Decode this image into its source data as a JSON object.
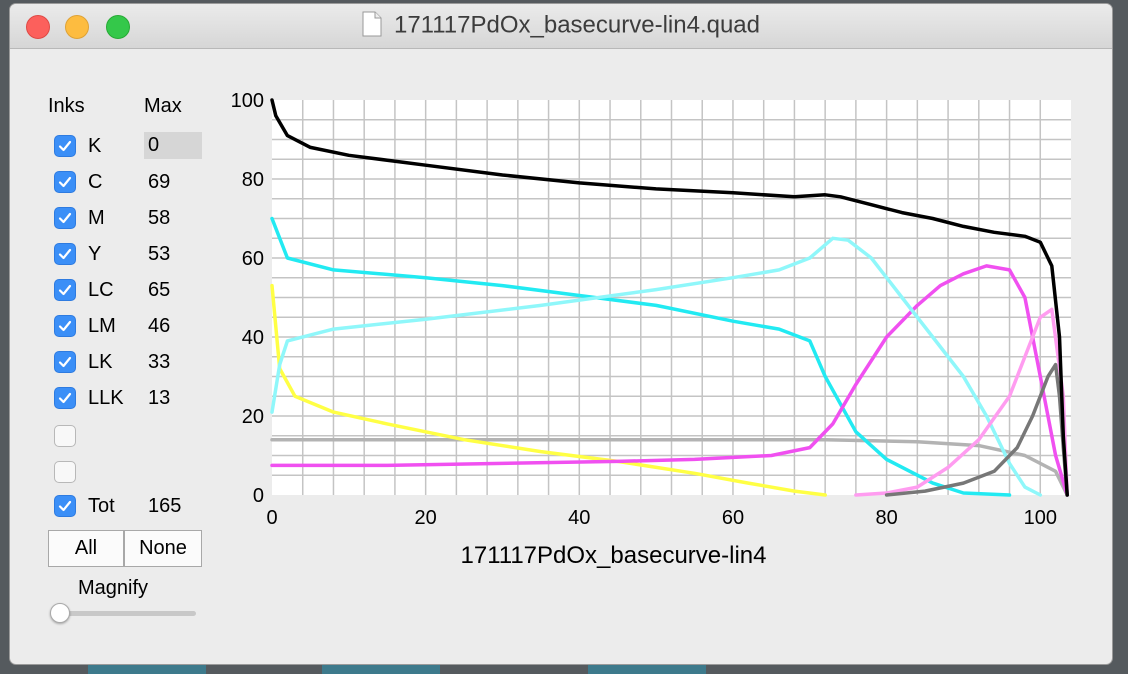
{
  "window": {
    "title": "171117PdOx_basecurve-lin4.quad"
  },
  "panel": {
    "inks_header": "Inks",
    "max_header": "Max",
    "inks": [
      {
        "name": "K",
        "max": "0",
        "checked": true
      },
      {
        "name": "C",
        "max": "69",
        "checked": true
      },
      {
        "name": "M",
        "max": "58",
        "checked": true
      },
      {
        "name": "Y",
        "max": "53",
        "checked": true
      },
      {
        "name": "LC",
        "max": "65",
        "checked": true
      },
      {
        "name": "LM",
        "max": "46",
        "checked": true
      },
      {
        "name": "LK",
        "max": "33",
        "checked": true
      },
      {
        "name": "LLK",
        "max": "13",
        "checked": true
      },
      {
        "name": "",
        "max": "",
        "checked": false
      },
      {
        "name": "",
        "max": "",
        "checked": false
      },
      {
        "name": "Tot",
        "max": "165",
        "checked": true
      }
    ],
    "all_label": "All",
    "none_label": "None",
    "magnify_label": "Magnify",
    "magnify_value": 0
  },
  "chart_data": {
    "type": "line",
    "xlabel": "171117PdOx_basecurve-lin4",
    "ylabel": "",
    "xlim": [
      0,
      104
    ],
    "ylim": [
      0,
      100
    ],
    "xticks": [
      0,
      20,
      40,
      60,
      80,
      100
    ],
    "yticks": [
      0,
      20,
      40,
      60,
      80,
      100
    ],
    "grid": true,
    "series": [
      {
        "color": "#b3b3b3",
        "points": [
          [
            0,
            14
          ],
          [
            20,
            14
          ],
          [
            40,
            14
          ],
          [
            60,
            14
          ],
          [
            72,
            14
          ],
          [
            84,
            13.5
          ],
          [
            92,
            12.5
          ],
          [
            98,
            10
          ],
          [
            102,
            6
          ],
          [
            103.5,
            0
          ]
        ]
      },
      {
        "color": "#ffff44",
        "points": [
          [
            0,
            53
          ],
          [
            1,
            32
          ],
          [
            3,
            25
          ],
          [
            8,
            21
          ],
          [
            15,
            18
          ],
          [
            25,
            14
          ],
          [
            35,
            11
          ],
          [
            45,
            8.5
          ],
          [
            55,
            5.5
          ],
          [
            62,
            3
          ],
          [
            68,
            1
          ],
          [
            72,
            0
          ]
        ]
      },
      {
        "color": "#22eaf2",
        "points": [
          [
            0,
            70
          ],
          [
            2,
            60
          ],
          [
            8,
            57
          ],
          [
            20,
            55
          ],
          [
            30,
            53
          ],
          [
            40,
            50.5
          ],
          [
            50,
            48
          ],
          [
            60,
            44
          ],
          [
            66,
            42
          ],
          [
            70,
            39
          ],
          [
            72,
            30
          ],
          [
            76,
            16
          ],
          [
            80,
            9
          ],
          [
            86,
            3
          ],
          [
            90,
            0.5
          ],
          [
            96,
            0
          ]
        ]
      },
      {
        "color": "#f050f0",
        "points": [
          [
            0,
            7.5
          ],
          [
            15,
            7.5
          ],
          [
            30,
            8
          ],
          [
            45,
            8.5
          ],
          [
            55,
            9
          ],
          [
            65,
            10
          ],
          [
            70,
            12
          ],
          [
            73,
            18
          ],
          [
            76,
            28
          ],
          [
            80,
            40
          ],
          [
            84,
            48
          ],
          [
            87,
            53
          ],
          [
            90,
            56
          ],
          [
            93,
            58
          ],
          [
            96,
            57
          ],
          [
            98,
            50
          ],
          [
            100,
            30
          ],
          [
            102,
            10
          ],
          [
            103.5,
            0
          ]
        ]
      },
      {
        "color": "#8ff7fa",
        "points": [
          [
            0,
            21
          ],
          [
            1,
            33
          ],
          [
            2,
            39
          ],
          [
            8,
            42
          ],
          [
            20,
            44.5
          ],
          [
            35,
            48
          ],
          [
            50,
            52
          ],
          [
            60,
            55
          ],
          [
            66,
            57
          ],
          [
            70,
            60
          ],
          [
            73,
            65
          ],
          [
            75,
            64.5
          ],
          [
            78,
            60
          ],
          [
            82,
            50
          ],
          [
            86,
            40
          ],
          [
            90,
            30
          ],
          [
            93,
            20
          ],
          [
            96,
            8
          ],
          [
            98,
            2
          ],
          [
            100,
            0
          ]
        ]
      },
      {
        "color": "#ff9cf0",
        "points": [
          [
            76,
            0
          ],
          [
            80,
            0.5
          ],
          [
            84,
            2
          ],
          [
            88,
            7
          ],
          [
            92,
            14
          ],
          [
            96,
            25
          ],
          [
            98,
            35
          ],
          [
            100,
            45
          ],
          [
            101.5,
            47
          ],
          [
            103,
            25
          ],
          [
            103.5,
            0
          ]
        ]
      },
      {
        "color": "#777777",
        "points": [
          [
            80,
            0
          ],
          [
            85,
            1
          ],
          [
            90,
            3
          ],
          [
            94,
            6
          ],
          [
            97,
            12
          ],
          [
            99,
            20
          ],
          [
            101,
            30
          ],
          [
            102,
            33
          ],
          [
            102.5,
            25
          ],
          [
            103,
            12
          ],
          [
            103.5,
            0
          ]
        ]
      },
      {
        "color": "#000000",
        "points": [
          [
            0,
            100
          ],
          [
            0.5,
            96
          ],
          [
            2,
            91
          ],
          [
            5,
            88
          ],
          [
            10,
            86
          ],
          [
            20,
            83.5
          ],
          [
            30,
            81
          ],
          [
            40,
            79
          ],
          [
            50,
            77.5
          ],
          [
            60,
            76.5
          ],
          [
            68,
            75.5
          ],
          [
            72,
            76
          ],
          [
            74,
            75.5
          ],
          [
            78,
            73.5
          ],
          [
            82,
            71.5
          ],
          [
            86,
            70
          ],
          [
            90,
            68
          ],
          [
            94,
            66.5
          ],
          [
            98,
            65.5
          ],
          [
            100,
            64
          ],
          [
            101.5,
            58
          ],
          [
            102.5,
            40
          ],
          [
            103,
            15
          ],
          [
            103.5,
            0
          ]
        ]
      }
    ]
  }
}
